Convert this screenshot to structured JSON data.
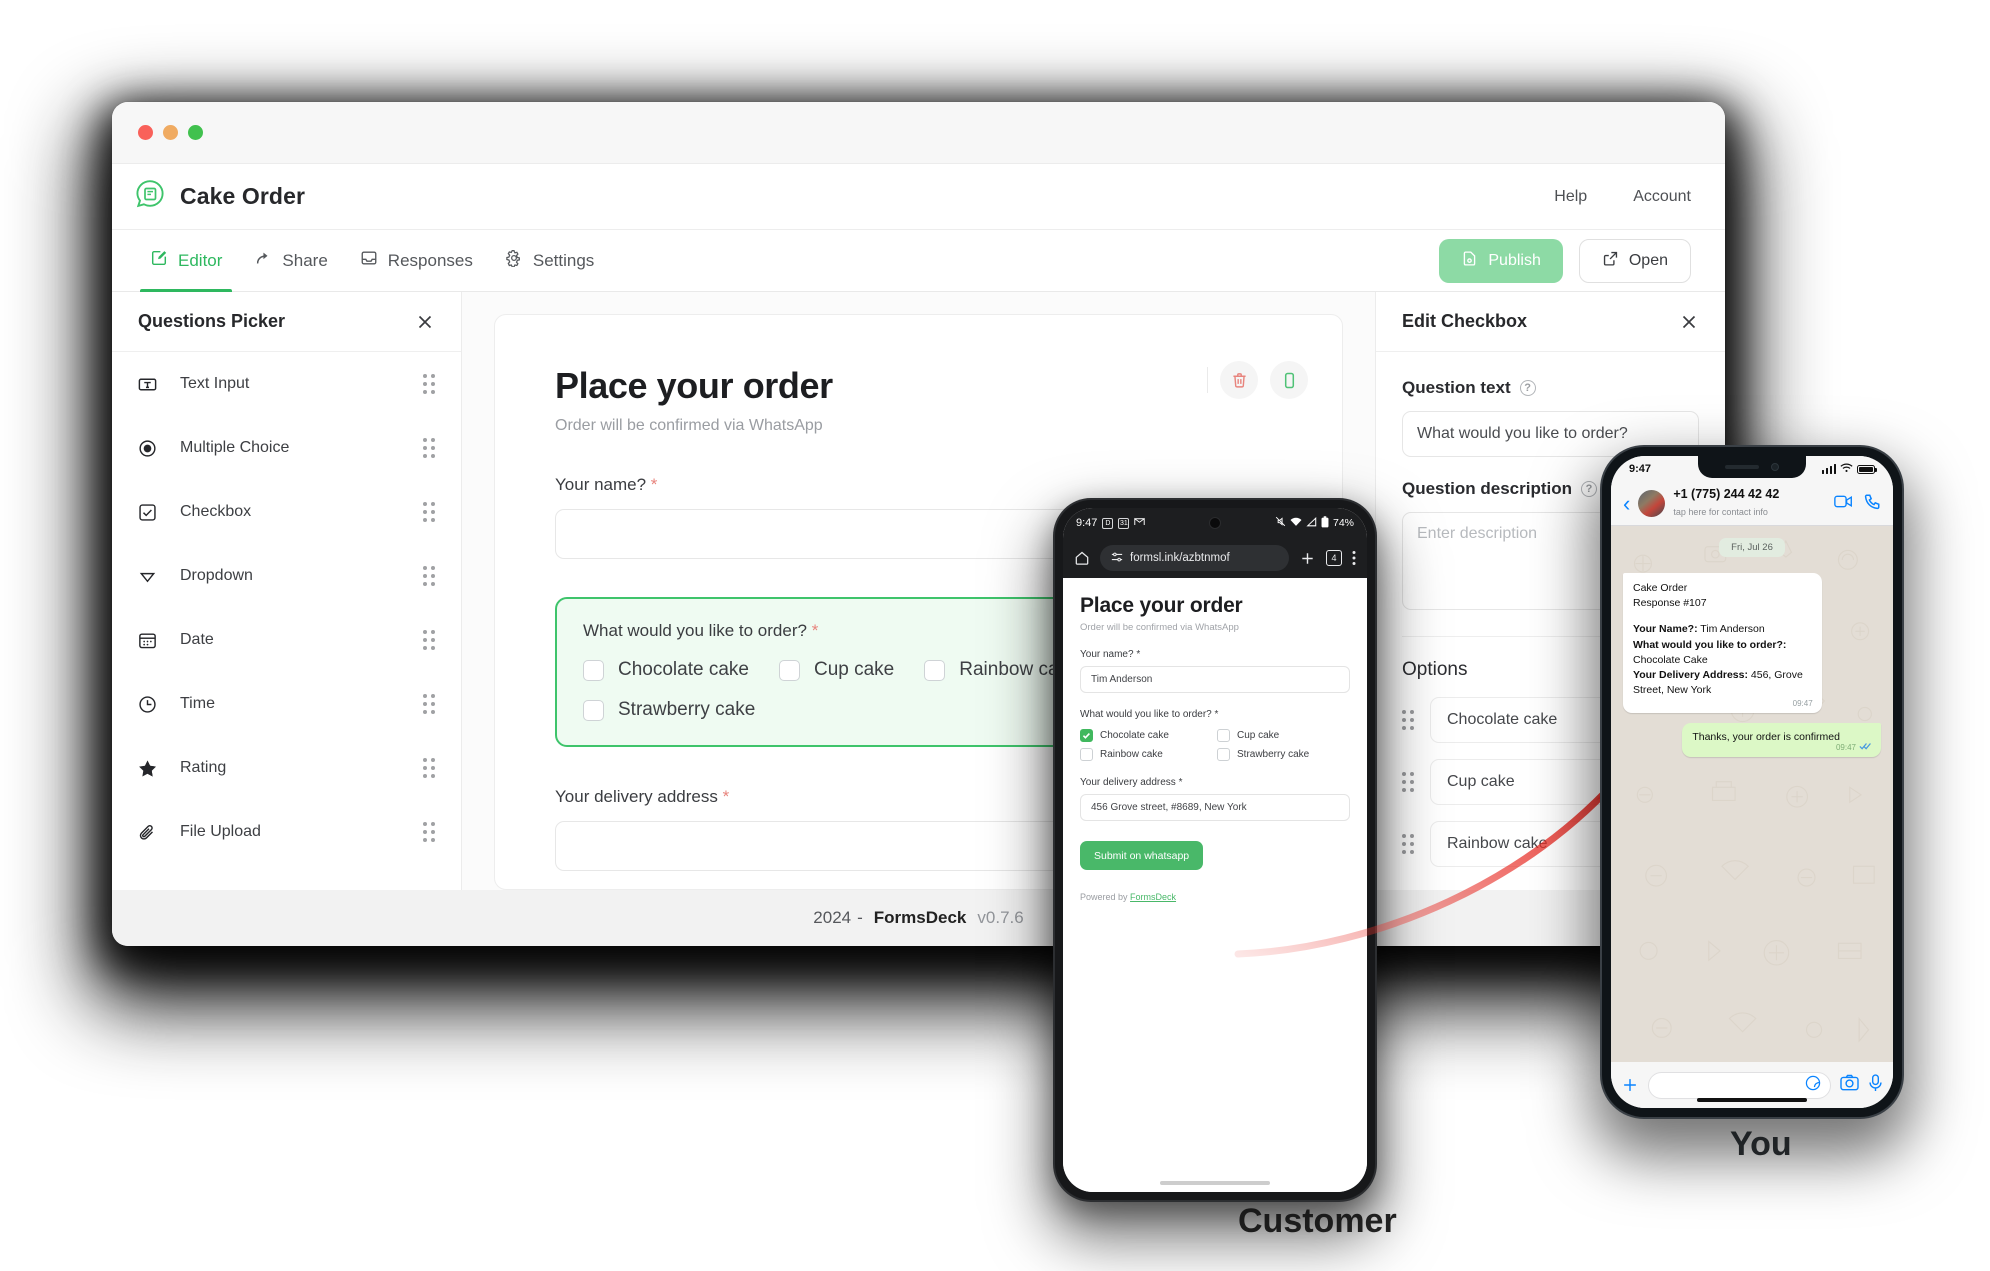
{
  "window": {
    "brand_title": "Cake Order",
    "header_links": [
      "Help",
      "Account"
    ],
    "tabs": [
      {
        "label": "Editor",
        "icon": "editor-pencil-icon",
        "active": true
      },
      {
        "label": "Share",
        "icon": "share-icon",
        "active": false
      },
      {
        "label": "Responses",
        "icon": "inbox-icon",
        "active": false
      },
      {
        "label": "Settings",
        "icon": "gear-icon",
        "active": false
      }
    ],
    "publish_button": "Publish",
    "open_button": "Open",
    "footer": {
      "year": "2024",
      "separator": "-",
      "product": "FormsDeck",
      "version": "v0.7.6"
    }
  },
  "questions_picker": {
    "title": "Questions Picker",
    "items": [
      {
        "label": "Text Input",
        "icon": "text-input-icon"
      },
      {
        "label": "Multiple Choice",
        "icon": "radio-icon"
      },
      {
        "label": "Checkbox",
        "icon": "checkbox-icon"
      },
      {
        "label": "Dropdown",
        "icon": "chevron-down-icon"
      },
      {
        "label": "Date",
        "icon": "calendar-icon"
      },
      {
        "label": "Time",
        "icon": "clock-icon"
      },
      {
        "label": "Rating",
        "icon": "star-icon"
      },
      {
        "label": "File Upload",
        "icon": "paperclip-icon"
      }
    ]
  },
  "form_canvas": {
    "title": "Place your order",
    "subtitle": "Order will be confirmed via WhatsApp",
    "name_field": {
      "label": "Your name?",
      "required": "*",
      "value": ""
    },
    "order_question": {
      "label": "What would you like to order?",
      "required": "*",
      "options": [
        "Chocolate cake",
        "Cup cake",
        "Rainbow cake",
        "Strawberry cake"
      ]
    },
    "address_field": {
      "label": "Your delivery address",
      "required": "*",
      "value": ""
    },
    "card_tools": [
      "delete-icon",
      "mobile-preview-icon"
    ]
  },
  "edit_panel": {
    "title": "Edit Checkbox",
    "question_text_label": "Question text",
    "question_text_value": "What would you like to order?",
    "question_description_label": "Question description",
    "question_description_placeholder": "Enter description",
    "options_label": "Options",
    "options": [
      "Chocolate cake",
      "Cup cake",
      "Rainbow cake"
    ]
  },
  "android_phone": {
    "status": {
      "time": "9:47",
      "battery": "74%"
    },
    "browser": {
      "url": "formsl.ink/azbtnmof",
      "tab_count": "4"
    },
    "page": {
      "title": "Place your order",
      "subtitle": "Order will be confirmed via WhatsApp",
      "name_label": "Your name? *",
      "name_value": "Tim Anderson",
      "order_label": "What would you like to order? *",
      "options": [
        {
          "label": "Chocolate cake",
          "checked": true
        },
        {
          "label": "Cup cake",
          "checked": false
        },
        {
          "label": "Rainbow cake",
          "checked": false
        },
        {
          "label": "Strawberry cake",
          "checked": false
        }
      ],
      "address_label": "Your delivery address *",
      "address_value": "456 Grove street, #8689, New York",
      "submit_label": "Submit on whatsapp",
      "powered_prefix": "Powered by ",
      "powered_link": "FormsDeck"
    }
  },
  "iphone": {
    "status": {
      "time": "9:47"
    },
    "chat_header": {
      "name": "+1 (775) 244 42 42",
      "subtitle": "tap here for contact info"
    },
    "day_divider": "Fri, Jul 26",
    "incoming": {
      "line1": "Cake Order",
      "line2": "Response #107",
      "f1_key": "Your Name?:",
      "f1_val": " Tim Anderson",
      "f2_key": "What would you like to order?:",
      "f2_val": " Chocolate Cake",
      "f3_key": "Your Delivery Address:",
      "f3_val": " 456, Grove Street, New York",
      "time": "09:47"
    },
    "outgoing": {
      "text": "Thanks, your order is confirmed",
      "time": "09:47",
      "ticks": "✓✓"
    }
  },
  "annotations": {
    "customer": "Customer",
    "you": "You"
  },
  "colors": {
    "accent_green": "#2eb85f",
    "publish_green": "#8ddaa5",
    "card_highlight_border": "#3ec46b",
    "card_highlight_bg": "#effbf2",
    "whatsapp_bubble": "#dcf8c6",
    "arrow_red": "#e8312a",
    "ios_blue": "#0a84ff"
  }
}
